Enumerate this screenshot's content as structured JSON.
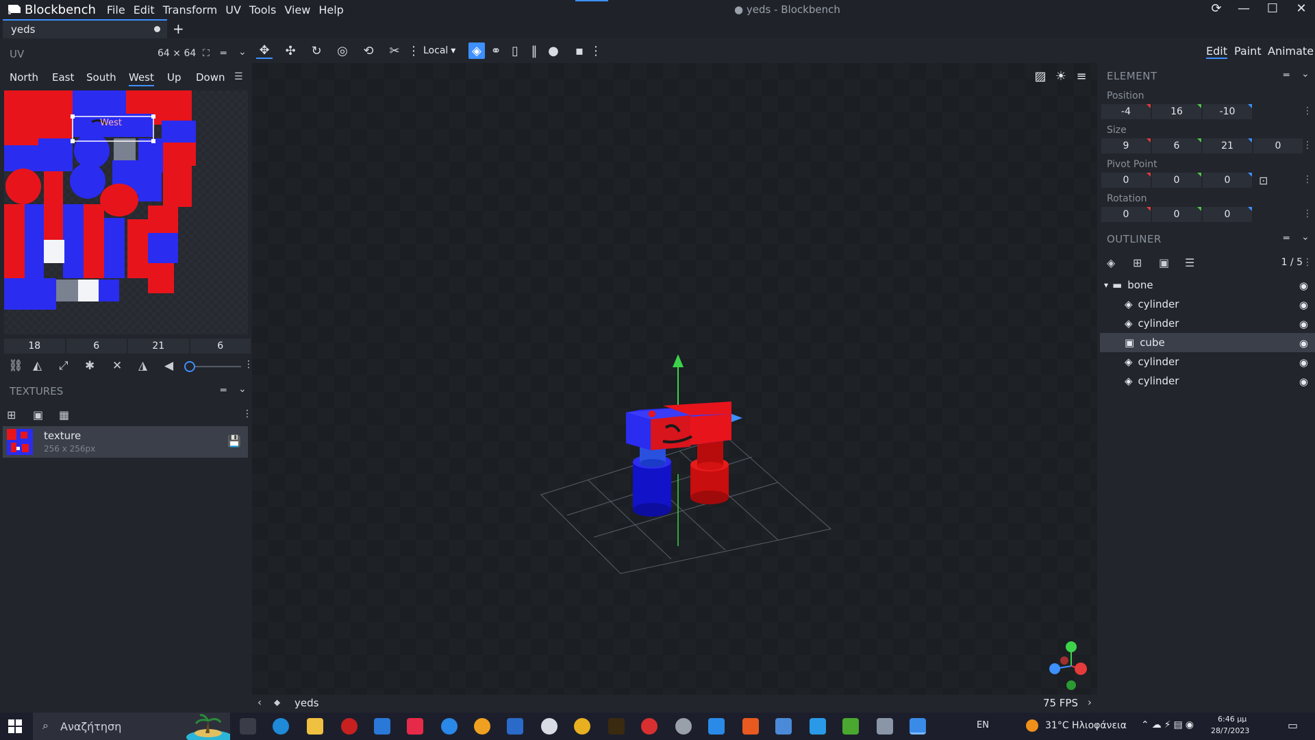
{
  "app": {
    "name": "Blockbench",
    "window_title": "yeds - Blockbench",
    "unsaved_marker": "●",
    "menu": [
      "File",
      "Edit",
      "Transform",
      "UV",
      "Tools",
      "View",
      "Help"
    ]
  },
  "tabs": [
    {
      "label": "yeds",
      "modified": true
    }
  ],
  "toolbar": {
    "transform_space": "Local",
    "modes": [
      "Edit",
      "Paint",
      "Animate"
    ],
    "active_mode": "Edit"
  },
  "uv_panel": {
    "title": "UV",
    "resolution": "64 ⨯ 64",
    "faces": [
      "North",
      "East",
      "South",
      "West",
      "Up",
      "Down"
    ],
    "active_face": "West",
    "face_overlay_label": "West",
    "uv_values": [
      "18",
      "6",
      "21",
      "6"
    ],
    "slider_fraction": 0.0
  },
  "textures_panel": {
    "title": "TEXTURES",
    "items": [
      {
        "name": "texture",
        "size": "256 x 256px"
      }
    ]
  },
  "element_panel": {
    "title": "ELEMENT",
    "position": {
      "label": "Position",
      "values": [
        "-4",
        "16",
        "-10"
      ]
    },
    "size": {
      "label": "Size",
      "values": [
        "9",
        "6",
        "21",
        "0"
      ]
    },
    "pivot": {
      "label": "Pivot Point",
      "values": [
        "0",
        "0",
        "0"
      ]
    },
    "rotation": {
      "label": "Rotation",
      "values": [
        "0",
        "0",
        "0"
      ]
    }
  },
  "outliner": {
    "title": "OUTLINER",
    "count": "1 / 5",
    "group": "bone",
    "items": [
      {
        "name": "cylinder",
        "type": "mesh",
        "selected": false
      },
      {
        "name": "cylinder",
        "type": "mesh",
        "selected": false
      },
      {
        "name": "cube",
        "type": "cube",
        "selected": true
      },
      {
        "name": "cylinder",
        "type": "mesh",
        "selected": false
      },
      {
        "name": "cylinder",
        "type": "mesh",
        "selected": false
      }
    ]
  },
  "status": {
    "model_name": "yeds",
    "fps": "75 FPS"
  },
  "taskbar": {
    "search_placeholder": "Αναζήτηση",
    "language": "EN",
    "weather": "31°C Ηλιοφάνεια",
    "time": "6:46 μμ",
    "date": "28/7/2023"
  },
  "colors": {
    "accent": "#3e90ff",
    "model_red": "#e8141c",
    "model_blue": "#2a2cf0"
  }
}
